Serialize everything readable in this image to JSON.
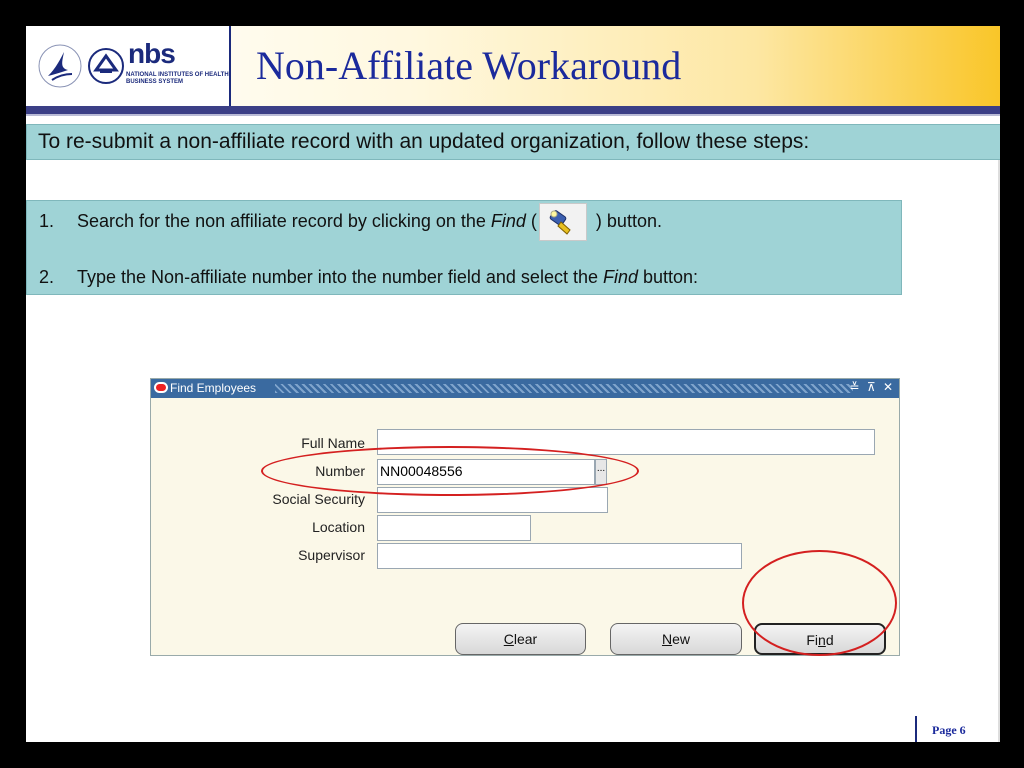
{
  "slide": {
    "title": "Non-Affiliate Workaround",
    "logo": {
      "brand": "nbs",
      "subtitle_line1": "NATIONAL INSTITUTES OF HEALTH",
      "subtitle_line2": "BUSINESS SYSTEM",
      "nih_seal_text": "NATIONAL INSTITUTES OF HEALTH",
      "icons": [
        "hhs-eagle-icon",
        "nih-seal-icon"
      ]
    },
    "intro": "To re-submit a non-affiliate record with an updated organization, follow these steps:",
    "steps": [
      {
        "num": "1.",
        "before": "Search for the non affiliate record by clicking on the ",
        "em": "Find",
        "mid": " (",
        "after": " ) button.",
        "icon": "flashlight-find-icon"
      },
      {
        "num": "2.",
        "before": "Type the Non-affiliate number into the number field and select the ",
        "em": "Find",
        "after": " button:"
      }
    ],
    "page_label": "Page 6"
  },
  "dialog": {
    "title": "Find Employees",
    "controls": "≚ ⊼ ✕",
    "fields": [
      {
        "label": "Full Name",
        "value": ""
      },
      {
        "label": "Number",
        "value": "NN00048556"
      },
      {
        "label": "Social Security",
        "value": ""
      },
      {
        "label": "Location",
        "value": ""
      },
      {
        "label": "Supervisor",
        "value": ""
      }
    ],
    "lov_button": "...",
    "buttons": {
      "clear": {
        "mnemonic": "C",
        "rest": "lear"
      },
      "new": {
        "mnemonic": "N",
        "rest": "ew"
      },
      "find": {
        "pre": "Fi",
        "mnemonic": "n",
        "rest": "d"
      }
    }
  },
  "colors": {
    "title_blue": "#1b2a9c",
    "banner_teal": "#9fd3d6",
    "highlight_red": "#d42020",
    "dialog_bg": "#fbf8e8",
    "titlebar_blue": "#3a6aa0"
  }
}
